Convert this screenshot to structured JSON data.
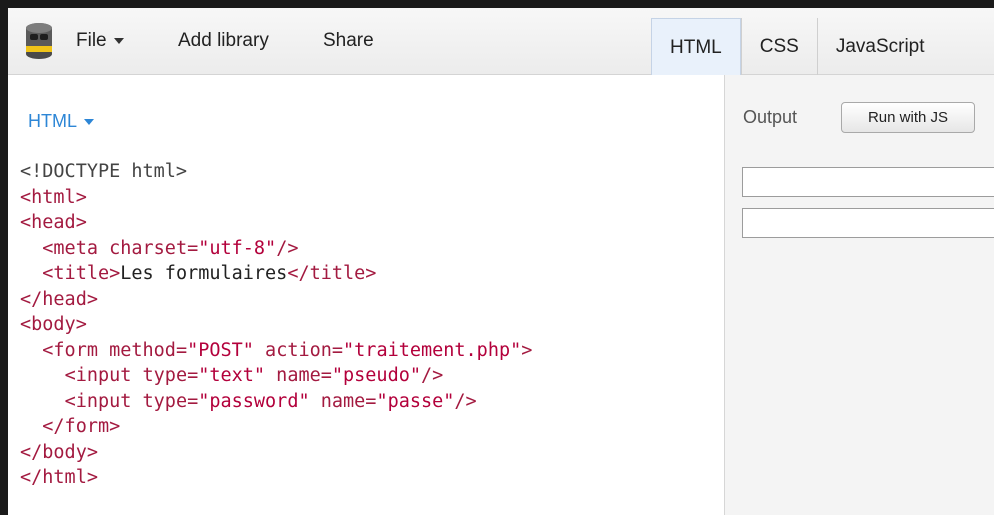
{
  "toolbar": {
    "logo_icon": "database-cylinder-icon",
    "menu": {
      "file": "File",
      "add_library": "Add library",
      "share": "Share"
    },
    "tabs": [
      {
        "label": "HTML",
        "active": true
      },
      {
        "label": "CSS",
        "active": false
      },
      {
        "label": "JavaScript",
        "active": false
      }
    ]
  },
  "editor": {
    "language": "HTML",
    "code": [
      "<!DOCTYPE html>",
      "<html>",
      "<head>",
      "  <meta charset=\"utf-8\"/>",
      "  <title>Les formulaires</title>",
      "</head>",
      "<body>",
      "  <form method=\"POST\" action=\"traitement.php\">",
      "    <input type=\"text\" name=\"pseudo\"/>",
      "    <input type=\"password\" name=\"passe\"/>",
      "  </form>",
      "</body>",
      "</html>"
    ]
  },
  "output": {
    "label": "Output",
    "run_button": "Run with JS",
    "inputs": [
      {
        "type": "text",
        "name": "pseudo",
        "value": ""
      },
      {
        "type": "password",
        "name": "passe",
        "value": ""
      }
    ]
  },
  "colors": {
    "accent_blue": "#2d86d6",
    "code_tag": "#a31a40",
    "code_string": "#b3003b",
    "active_tab_bg": "#e9f1fb"
  }
}
